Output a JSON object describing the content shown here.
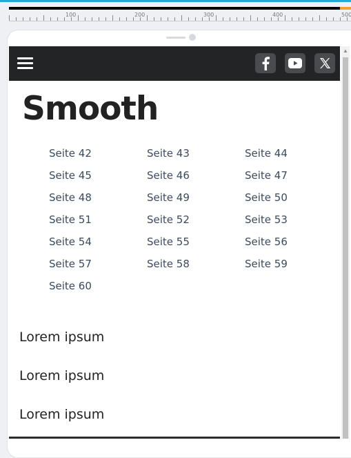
{
  "ruler": {
    "labels": [
      "100",
      "200",
      "300",
      "400",
      "500"
    ]
  },
  "navbar": {
    "menu_icon": "hamburger-menu-icon",
    "social": [
      {
        "name": "facebook",
        "icon": "facebook-icon"
      },
      {
        "name": "youtube",
        "icon": "youtube-icon"
      },
      {
        "name": "x",
        "icon": "x-twitter-icon"
      }
    ]
  },
  "main": {
    "title": "Smooth",
    "pages": [
      "Seite 42",
      "Seite 43",
      "Seite 44",
      "Seite 45",
      "Seite 46",
      "Seite 47",
      "Seite 48",
      "Seite 49",
      "Seite 50",
      "Seite 51",
      "Seite 52",
      "Seite 53",
      "Seite 54",
      "Seite 55",
      "Seite 56",
      "Seite 57",
      "Seite 58",
      "Seite 59",
      "Seite 60"
    ],
    "sections": [
      "Lorem ipsum",
      "Lorem ipsum",
      "Lorem ipsum"
    ]
  },
  "colors": {
    "navbar_bg": "#232426",
    "social_bg": "#4a4b4e",
    "link": "#3b4a5c",
    "accent": "#27a9d6"
  }
}
